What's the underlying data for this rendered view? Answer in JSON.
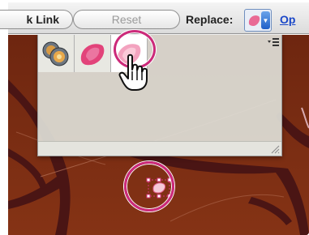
{
  "control_bar": {
    "link_button_label": "k Link",
    "reset_button_label": "Reset",
    "replace_label": "Replace:",
    "options_link_label": "Op"
  },
  "icons": {
    "palette_menu": "palette-menu-icon",
    "hand_cursor": "hand-pointer-cursor-icon",
    "resize_grip": "resize-grip-icon",
    "dropdown": "dropdown-arrow-icon"
  },
  "colors": {
    "canvas_background": "#7a2c10",
    "highlight_callout": "#cc2a7a",
    "symbol_pink": "#e25c8a",
    "link_blue": "#1a47c8"
  },
  "symbols_palette": {
    "swatches": [
      {
        "name": "globe-symbol",
        "selected": false
      },
      {
        "name": "pink-petal-symbol",
        "selected": false
      },
      {
        "name": "light-pink-petal-symbol",
        "selected": true
      }
    ]
  }
}
